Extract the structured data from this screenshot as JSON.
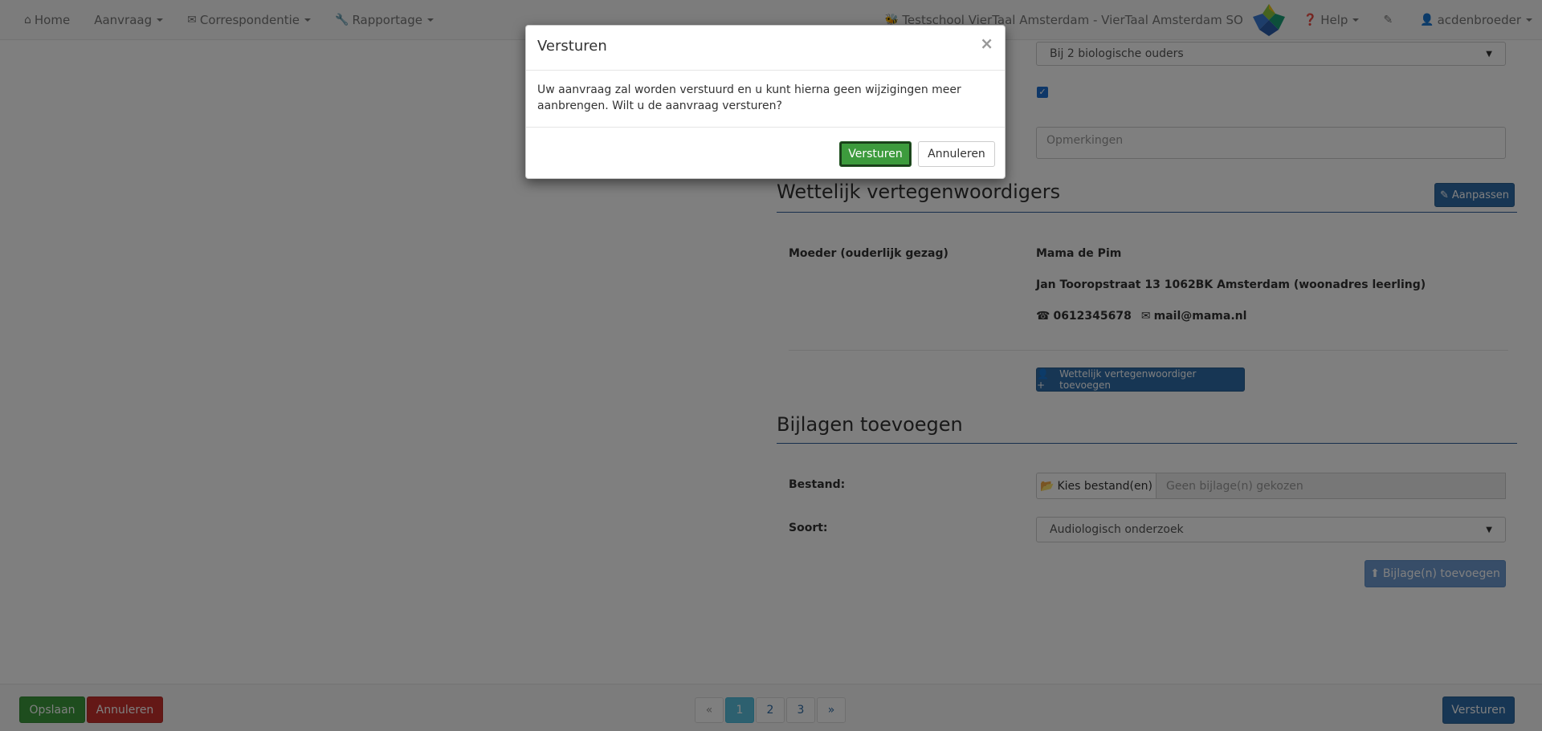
{
  "navbar": {
    "home": "Home",
    "aanvraag": "Aanvraag",
    "correspondentie": "Correspondentie",
    "rapportage": "Rapportage",
    "school": "Testschool VierTaal Amsterdam - VierTaal Amsterdam SO",
    "help": "Help",
    "user": "acdenbroeder"
  },
  "form": {
    "woonsituatie_value": "Bij 2 biologische ouders",
    "opmerkingen_placeholder": "Opmerkingen"
  },
  "representatives": {
    "title": "Wettelijk vertegenwoordigers",
    "edit_label": "Aanpassen",
    "role": "Moeder (ouderlijk gezag)",
    "name": "Mama de Pim",
    "address": "Jan Tooropstraat 13 1062BK Amsterdam (woonadres leerling)",
    "phone": "0612345678",
    "email": "mail@mama.nl",
    "add_label": "Wettelijk vertegenwoordiger toevoegen"
  },
  "attachments": {
    "title": "Bijlagen toevoegen",
    "file_label": "Bestand:",
    "choose_label": "Kies bestand(en)",
    "no_file": "Geen bijlage(n) gekozen",
    "type_label": "Soort:",
    "type_value": "Audiologisch onderzoek",
    "add_label": "Bijlage(n) toevoegen"
  },
  "footer": {
    "save": "Opslaan",
    "cancel": "Annuleren",
    "pages": [
      "«",
      "1",
      "2",
      "3",
      "»"
    ],
    "current_page": "1",
    "send": "Versturen"
  },
  "modal": {
    "title": "Versturen",
    "close": "×",
    "body": "Uw aanvraag zal worden verstuurd en u kunt hierna geen wijzigingen meer aanbrengen. Wilt u de aanvraag versturen?",
    "confirm": "Versturen",
    "cancel": "Annuleren"
  },
  "colors": {
    "primary": "#2f6ca8",
    "success": "#3d9b3d",
    "danger": "#c9302c",
    "active_page": "#5bc0de"
  }
}
